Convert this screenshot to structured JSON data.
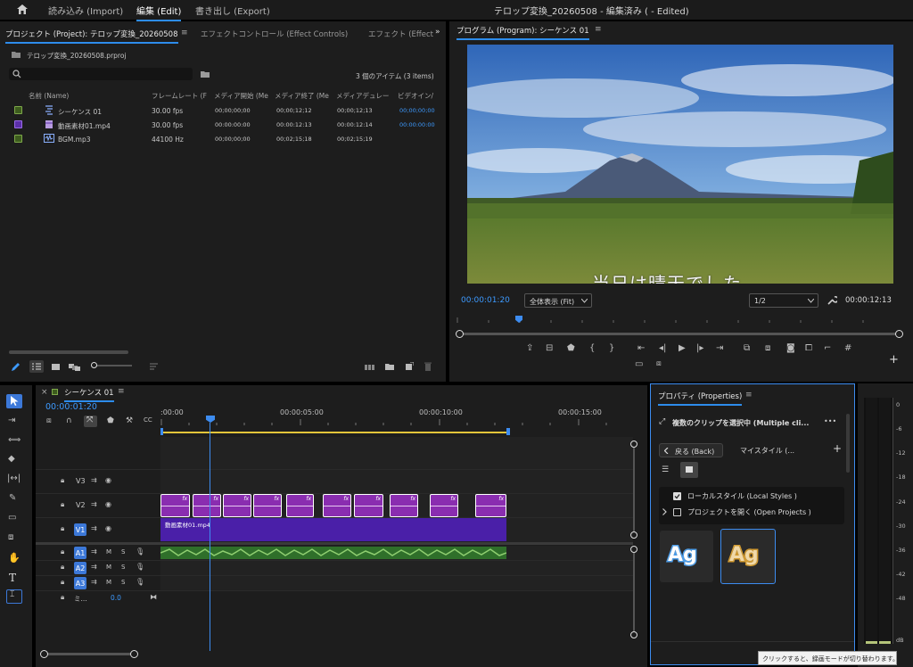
{
  "menu": {
    "home_icon": "home-icon",
    "tabs": [
      "読み込み (Import)",
      "編集 (Edit)",
      "書き出し (Export)"
    ],
    "active_tab": "編集 (Edit)",
    "window_title": "テロップ変換_20260508 - 編集済み ( - Edited)"
  },
  "project_panel": {
    "tabs": [
      "プロジェクト (Project): テロップ変換_20260508",
      "エフェクトコントロール (Effect Controls)",
      "エフェクト (Effect"
    ],
    "menu_glyph": "≡",
    "overflow_glyph": "»",
    "project_file": "テロップ変換_20260508.prproj",
    "search_placeholder": "",
    "item_count": "3 個のアイテム (3 items)",
    "columns": [
      "名前 (Name)",
      "フレームレート (F",
      "メディア開始 (Me",
      "メディア終了 (Me",
      "メディアデュレー",
      "ビデオイン/"
    ],
    "items": [
      {
        "name": "シーケンス 01",
        "color": "#3d5c1e",
        "fps": "30.00 fps",
        "start": "00;00;00;00",
        "end": "00;00;12;12",
        "dur": "00;00;12;13",
        "vin": "00;00;00;00"
      },
      {
        "name": "動画素材01.mp4",
        "color": "#5b2fa8",
        "fps": "30.00 fps",
        "start": "00:00:00:00",
        "end": "00:00:12:13",
        "dur": "00:00:12:14",
        "vin": "00:00:00:00"
      },
      {
        "name": "BGM.mp3",
        "color": "#3d5c1e",
        "fps": "44100 Hz",
        "start": "00;00;00;00",
        "end": "00;02;15;18",
        "dur": "00;02;15;19",
        "vin": ""
      }
    ]
  },
  "program_monitor": {
    "title": "プログラム (Program): シーケンス 01",
    "menu_glyph": "≡",
    "caption": "当日は晴天でした",
    "timecode": "00:00:01:20",
    "fit_label": "全体表示 (Fit)",
    "resolution": "1/2",
    "duration": "00:00:12:13",
    "playhead_fraction": 0.137
  },
  "timeline": {
    "sequence_tab": "シーケンス 01",
    "close_glyph": "×",
    "menu_glyph": "≡",
    "timecode": "00:00:01:20",
    "ruler": [
      ":00:00",
      "00:00:05:00",
      "00:00:10:00",
      "00:00:15:00"
    ],
    "tracks": {
      "video": [
        "V3",
        "V2",
        "V1"
      ],
      "audio": [
        "A1",
        "A2",
        "A3"
      ],
      "mix_label": "ミ...",
      "mix_value": "0.0",
      "mute": "M",
      "solo": "S"
    },
    "v1_clip_name": "動画素材01.mp4",
    "fx_label": "fx"
  },
  "properties": {
    "title": "プロパティ (Properties)",
    "menu_glyph": "≡",
    "selection_label": "複数のクリップを選択中 (Multiple cli...",
    "more_glyph": "•••",
    "back_label": "戻る (Back)",
    "my_styles": "マイスタイル (...",
    "add_glyph": "+",
    "local_styles": "ローカルスタイル (Local Styles )",
    "open_projects": "プロジェクトを開く (Open Projects )",
    "style_sample": "Ag"
  },
  "meters": {
    "labels": [
      "0",
      "-6",
      "-12",
      "-18",
      "-24",
      "-30",
      "-36",
      "-42",
      "-48",
      "dB"
    ]
  },
  "tooltip": "クリックすると、録画モードが切り替わります。",
  "colors": {
    "accent": "#2d8ceb",
    "clip_purple": "#8a2db0",
    "audio_green": "#2f6f2a",
    "yellow_bar": "#e3c53a"
  }
}
